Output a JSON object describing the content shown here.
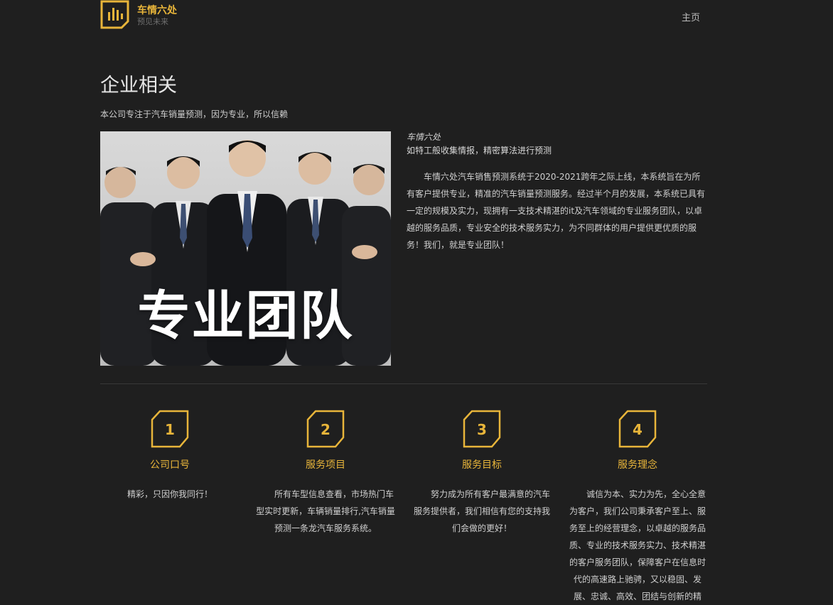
{
  "header": {
    "brand_title": "车情六处",
    "brand_subtitle": "预见未来",
    "nav_home": "主页"
  },
  "about": {
    "title": "企业相关",
    "intro": "本公司专注于汽车销量预测，因为专业，所以信赖",
    "photo_caption": "专业团队",
    "side_brand": "车情六处",
    "side_tagline": "如特工般收集情报，精密算法进行预测",
    "side_body": "车情六处汽车销售预测系统于2020-2021跨年之际上线，本系统旨在为所有客户提供专业，精准的汽车销量预测服务。经过半个月的发展，本系统已具有一定的规模及实力，现拥有一支技术精湛的it及汽车领域的专业服务团队，以卓越的服务品质，专业安全的技术服务实力，为不同群体的用户提供更优质的服务！我们，就是专业团队！"
  },
  "features": [
    {
      "number": "1",
      "title": "公司口号",
      "desc": "精彩，只因你我同行！"
    },
    {
      "number": "2",
      "title": "服务项目",
      "desc": "所有车型信息查看，市场热门车型实时更新，车辆销量排行,汽车销量预测一条龙汽车服务系统。"
    },
    {
      "number": "3",
      "title": "服务目标",
      "desc": "努力成为所有客户最满意的汽车服务提供者，我们相信有您的支持我们会做的更好！"
    },
    {
      "number": "4",
      "title": "服务理念",
      "desc": "诚信为本、实力为先，全心全意为客户，我们公司秉承客户至上、服务至上的经营理念，以卓越的服务品质、专业的技术服务实力、技术精湛的客户服务团队，保障客户在信息时代的高速路上驰骋，又以稳固、发展、忠诚、高效、团结与创新的精"
    }
  ],
  "colors": {
    "accent": "#e8b53a",
    "background": "#1f1f1f"
  }
}
